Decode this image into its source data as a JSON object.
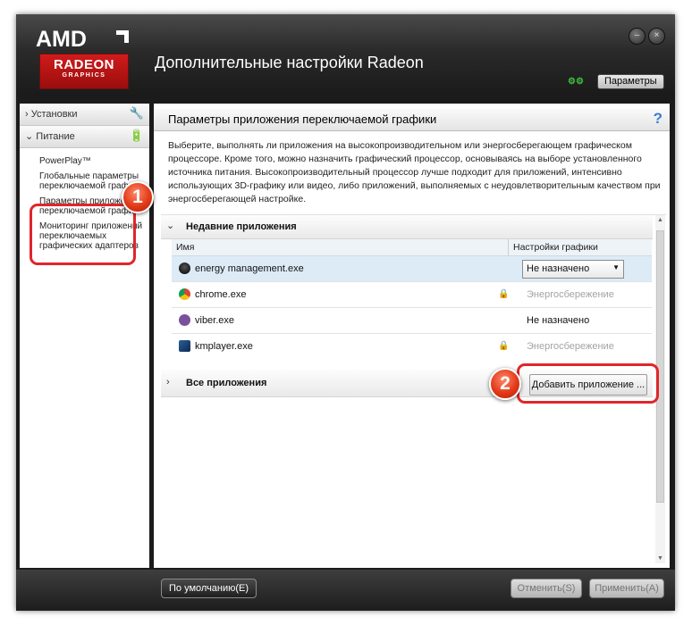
{
  "window": {
    "title": "Дополнительные настройки Radeon",
    "logo": {
      "brand": "AMD",
      "product": "RADEON",
      "subtitle": "GRAPHICS"
    },
    "minimize_icon": "minimize-icon",
    "close_icon": "close-icon",
    "params_label": "Параметры"
  },
  "sidebar": {
    "sections": [
      {
        "label": "Установки",
        "collapsed": true,
        "icon": "tools-icon"
      },
      {
        "label": "Питание",
        "collapsed": false,
        "icon": "battery-icon"
      }
    ],
    "items": [
      "PowerPlay™",
      "Глобальные параметры переключаемой графики",
      "Параметры приложения переключаемой графики",
      "Мониторинг приложений переключаемых графических адаптеров"
    ]
  },
  "main": {
    "title": "Параметры приложения переключаемой графики",
    "help": "?",
    "description": "Выберите, выполнять ли приложения на высокопроизводительном или энергосберегающем графическом процессоре. Кроме того, можно назначить графический процессор, основываясь на выборе установленного источника питания. Высокопроизводительный процессор лучше подходит для приложений, интенсивно использующих 3D-графику или видео, либо приложений, выполняемых с неудовлетворительным качеством при энергосберегающей настройке.",
    "recent": {
      "title": "Недавние приложения",
      "columns": [
        "Имя",
        "Настройки графики"
      ],
      "rows": [
        {
          "name": "energy management.exe",
          "setting": "Не назначено",
          "locked": false,
          "dropdown": true,
          "icon": "energy-management-icon"
        },
        {
          "name": "chrome.exe",
          "setting": "Энергосбережение",
          "locked": true,
          "dropdown": false,
          "icon": "chrome-icon"
        },
        {
          "name": "viber.exe",
          "setting": "Не назначено",
          "locked": false,
          "dropdown": false,
          "icon": "viber-icon"
        },
        {
          "name": "kmplayer.exe",
          "setting": "Энергосбережение",
          "locked": true,
          "dropdown": false,
          "icon": "kmplayer-icon"
        }
      ]
    },
    "all_apps": {
      "title": "Все приложения",
      "add_button": "Добавить приложение ..."
    }
  },
  "footer": {
    "default_button": "По умолчанию(E)",
    "cancel_button": "Отменить(S)",
    "apply_button": "Применить(A)"
  },
  "annotations": [
    {
      "number": "1",
      "color": "#e0262b"
    },
    {
      "number": "2",
      "color": "#e0262b"
    }
  ]
}
